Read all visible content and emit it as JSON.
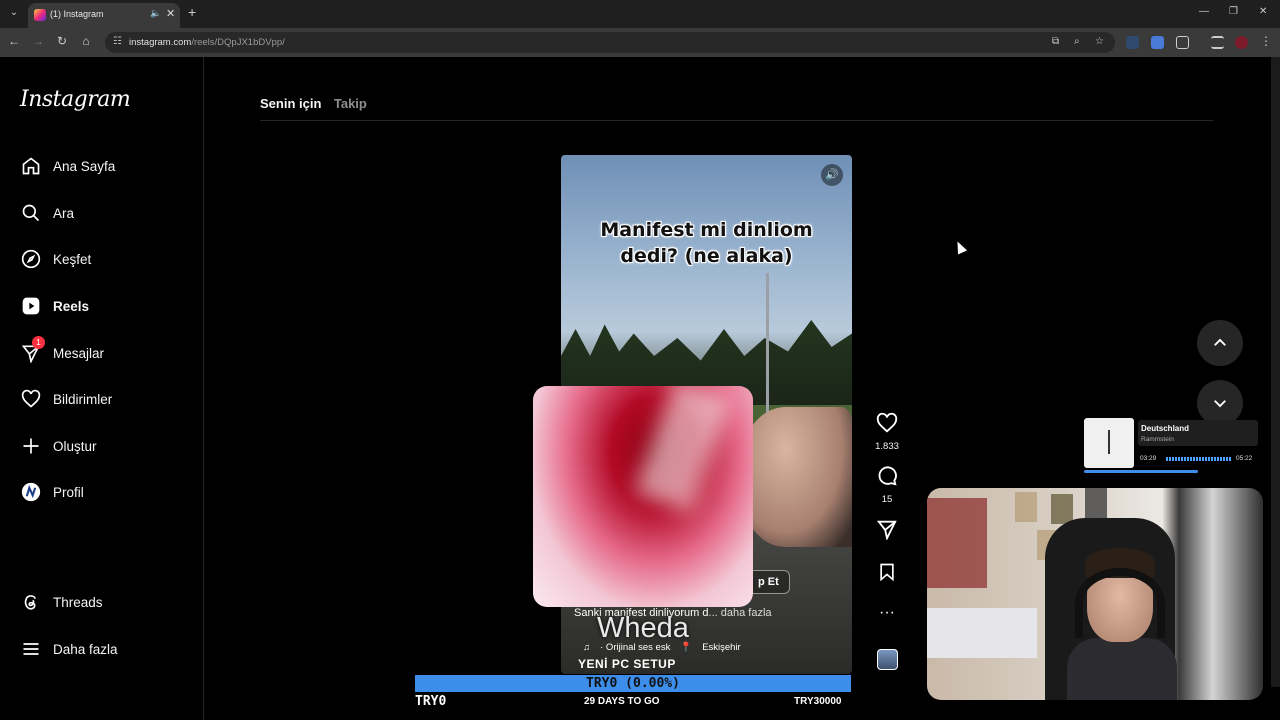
{
  "browser": {
    "tab_title": "(1) Instagram",
    "url_host": "instagram.com",
    "url_path": "/reels/DQpJX1bDVpp/"
  },
  "sidebar": {
    "logo": "Instagram",
    "items": [
      {
        "label": "Ana Sayfa",
        "icon": "home-icon"
      },
      {
        "label": "Ara",
        "icon": "search-icon"
      },
      {
        "label": "Keşfet",
        "icon": "compass-icon"
      },
      {
        "label": "Reels",
        "icon": "reels-icon"
      },
      {
        "label": "Mesajlar",
        "icon": "messenger-icon",
        "badge": "1"
      },
      {
        "label": "Bildirimler",
        "icon": "heart-icon"
      },
      {
        "label": "Oluştur",
        "icon": "plus-icon"
      },
      {
        "label": "Profil",
        "icon": "avatar-icon"
      },
      {
        "label": "Threads",
        "icon": "threads-icon"
      },
      {
        "label": "Daha fazla",
        "icon": "menu-icon"
      }
    ]
  },
  "feed_tabs": [
    "Senin için",
    "Takip"
  ],
  "reel": {
    "overlay_text_line1": "Manifest mi dinliom",
    "overlay_text_line2": "dedi? (ne alaka)",
    "follow_label": "p Et",
    "caption": "Sanki manifest dinliyorum d",
    "caption_more": "... daha fazla",
    "audio": "· Orijinal ses  esk",
    "location": "Eskişehir",
    "likes": "1.833",
    "comments": "15"
  },
  "stream": {
    "name": "Wheda",
    "goal_title": "YENİ PC SETUP",
    "goal_bar": "TRY0 (0.00%)",
    "goal_current": "TRY0",
    "goal_days": "29 DAYS TO GO",
    "goal_target": "TRY30000"
  },
  "music": {
    "title": "Deutschland",
    "artist": "Rammstein",
    "elapsed": "03:29",
    "total": "05:22"
  },
  "colors": {
    "accent_blue": "#3d8eea",
    "badge_red": "#ff3040"
  }
}
